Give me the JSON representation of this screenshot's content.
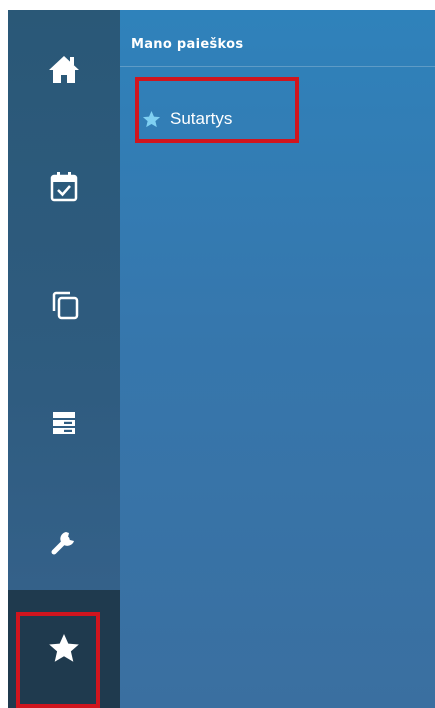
{
  "sidebar": {
    "items": [
      {
        "icon": "home-icon",
        "state": "default"
      },
      {
        "icon": "calendar-check-icon",
        "state": "default"
      },
      {
        "icon": "copy-icon",
        "state": "default"
      },
      {
        "icon": "server-list-icon",
        "state": "default"
      },
      {
        "icon": "wrench-icon",
        "state": "default"
      },
      {
        "icon": "star-icon",
        "state": "active"
      }
    ]
  },
  "panel": {
    "title": "Mano paieškos",
    "items": [
      {
        "label": "Sutartys",
        "icon": "star-icon"
      }
    ]
  },
  "colors": {
    "sidebar_bg": "#2f5c80",
    "sidebar_active": "#1f3a4e",
    "panel_bg": "#3677ad",
    "icon_white": "#ffffff",
    "star_accent": "#7fd0f2",
    "highlight_red": "#d0151e"
  }
}
